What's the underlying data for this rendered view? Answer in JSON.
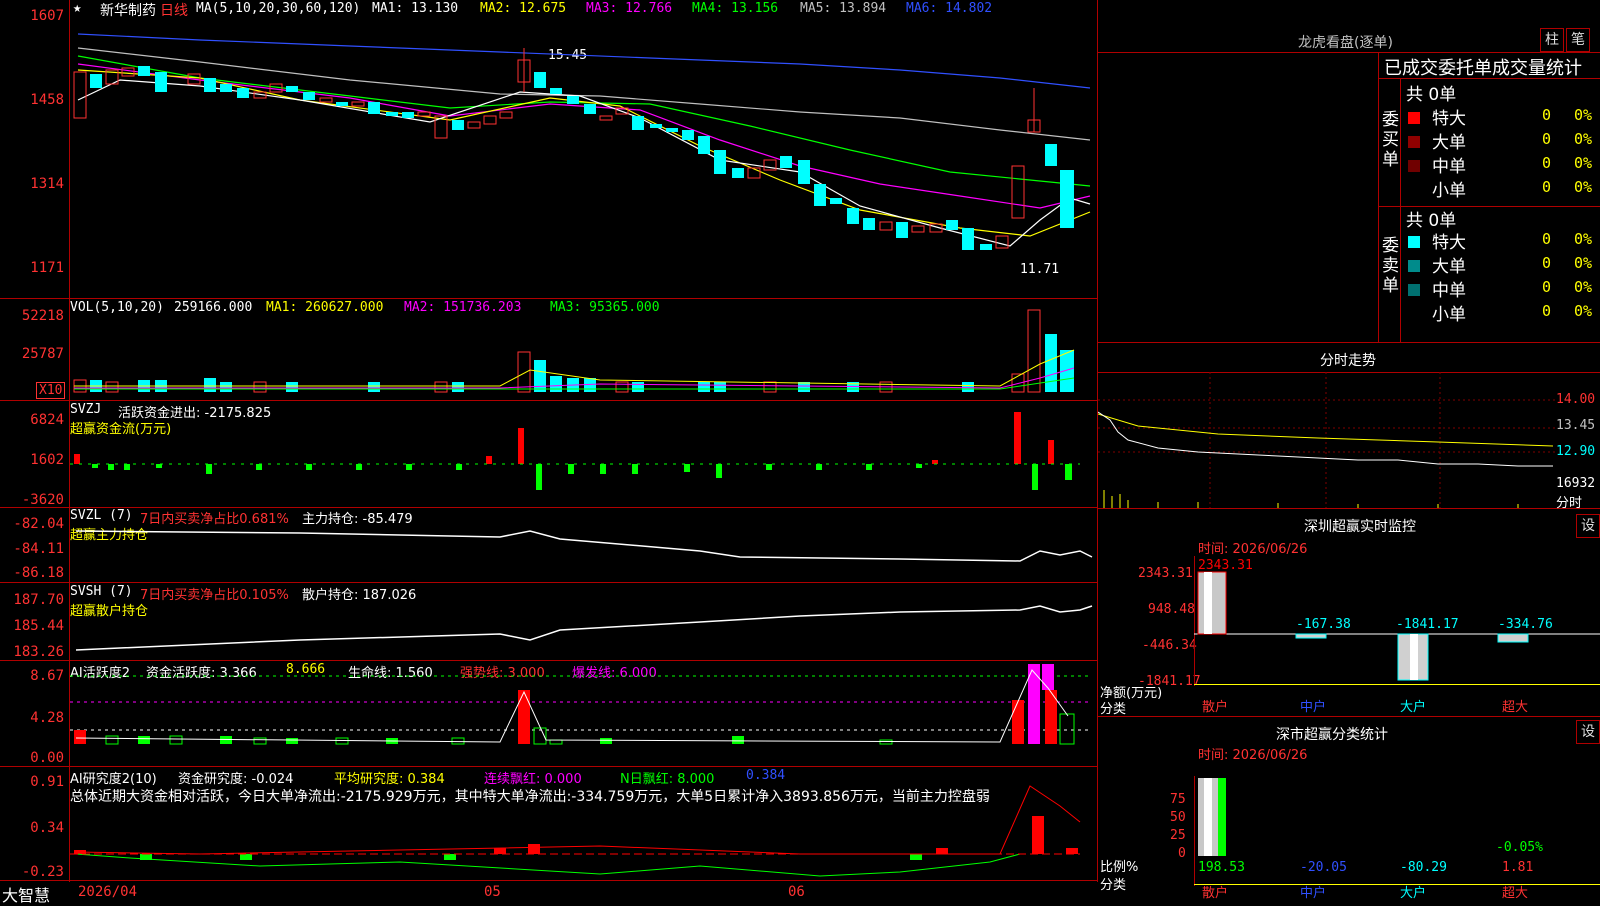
{
  "stock": {
    "name": "新华制药",
    "period": "日线",
    "ma_params": "MA(5,10,20,30,60,120)",
    "ma1": "MA1: 13.130",
    "ma2": "MA2: 12.675",
    "ma3": "MA3: 12.766",
    "ma4": "MA4: 13.156",
    "ma5": "MA5: 13.894",
    "ma6": "MA6: 14.802",
    "price_high_label": "15.45",
    "price_low_label": "11.71",
    "yaxis": [
      "1607",
      "1458",
      "1314",
      "1171"
    ]
  },
  "vol": {
    "title": "VOL(5,10,20)",
    "value": "259166.000",
    "ma1": "MA1: 260627.000",
    "ma2": "MA2: 151736.203",
    "ma3": "MA3: 95365.000",
    "yaxis": [
      "52218",
      "25787"
    ],
    "multiplier": "X10"
  },
  "svzj": {
    "title": "SVZJ",
    "label": "活跃资金进出: -2175.825",
    "subtitle": "超赢资金流(万元)",
    "yaxis": [
      "6824",
      "1602",
      "-3620"
    ]
  },
  "svzl": {
    "title": "SVZL (7)",
    "ratio": "7日内买卖净占比0.681%",
    "hold": "主力持仓: -85.479",
    "subtitle": "超赢主力持仓",
    "yaxis": [
      "-82.04",
      "-84.11",
      "-86.18"
    ]
  },
  "svsh": {
    "title": "SVSH (7)",
    "ratio": "7日内买卖净占比0.105%",
    "hold": "散户持仓: 187.026",
    "subtitle": "超赢散户持仓",
    "yaxis": [
      "187.70",
      "185.44",
      "183.26"
    ]
  },
  "ai_active": {
    "title": "AI活跃度2",
    "fund": "资金活跃度: 3.366",
    "v2": "8.666",
    "life": "生命线: 1.560",
    "strong": "强势线: 3.000",
    "burst": "爆发线: 6.000",
    "yaxis": [
      "8.67",
      "4.28",
      "0.00"
    ]
  },
  "ai_research": {
    "title": "AI研究度2(10)",
    "research": "资金研究度: -0.024",
    "avg": "平均研究度: 0.384",
    "cont": "连续飘红: 0.000",
    "nday": "N日飘红: 8.000",
    "last": "0.384",
    "summary": "总体近期大资金相对活跃，今日大单净流出:-2175.929万元，其中特大单净流出:-334.759万元，大单5日累计净入3893.856万元，当前主力控盘弱",
    "yaxis": [
      "0.91",
      "0.34",
      "-0.23"
    ]
  },
  "bottom": {
    "brand": "大智慧",
    "dates": [
      "2026/04",
      "05",
      "06"
    ]
  },
  "dragon": {
    "title": "龙虎看盘(逐单)",
    "btn1": "柱",
    "btn2": "笔",
    "stat_title": "已成交委托单成交量统计",
    "buy_label": "委买单",
    "sell_label": "委卖单",
    "buy_total": "共 0单",
    "sell_total": "共 0单",
    "buy_rows": [
      {
        "name": "特大",
        "v": "0",
        "p": "0%",
        "color": "#ff0000"
      },
      {
        "name": "大单",
        "v": "0",
        "p": "0%",
        "color": "#900000"
      },
      {
        "name": "中单",
        "v": "0",
        "p": "0%",
        "color": "#700000"
      },
      {
        "name": "小单",
        "v": "0",
        "p": "0%",
        "color": "#000000"
      }
    ],
    "sell_rows": [
      {
        "name": "特大",
        "v": "0",
        "p": "0%",
        "color": "#00ffff"
      },
      {
        "name": "大单",
        "v": "0",
        "p": "0%",
        "color": "#008b8b"
      },
      {
        "name": "中单",
        "v": "0",
        "p": "0%",
        "color": "#007070"
      },
      {
        "name": "小单",
        "v": "0",
        "p": "0%",
        "color": "#000000"
      }
    ]
  },
  "intraday": {
    "title": "分时走势",
    "yaxis": [
      "14.00",
      "13.45",
      "12.90"
    ],
    "vol_label": "16932",
    "fen": "分时"
  },
  "sz_monitor": {
    "title": "深圳超赢实时监控",
    "set": "设",
    "time": "时间: 2026/06/26",
    "yaxis": [
      "2343.31",
      "948.48",
      "-446.34",
      "-1841.17"
    ],
    "unit": "净额(万元)",
    "cat": "分类",
    "bars": [
      {
        "name": "散户",
        "value": "2343.31"
      },
      {
        "name": "中户",
        "value": "-167.38"
      },
      {
        "name": "大户",
        "value": "-1841.17"
      },
      {
        "name": "超大",
        "value": "-334.76"
      }
    ]
  },
  "sz_stat": {
    "title": "深市超赢分类统计",
    "set": "设",
    "time": "时间: 2026/06/26",
    "yaxis": [
      "75",
      "50",
      "25",
      "0"
    ],
    "unit": "比例%",
    "cat": "分类",
    "extra": "-0.05%",
    "bars": [
      {
        "name": "散户",
        "value": "198.53"
      },
      {
        "name": "中户",
        "value": "-20.05"
      },
      {
        "name": "大户",
        "value": "-80.29"
      },
      {
        "name": "超大",
        "value": "1.81"
      }
    ]
  }
}
